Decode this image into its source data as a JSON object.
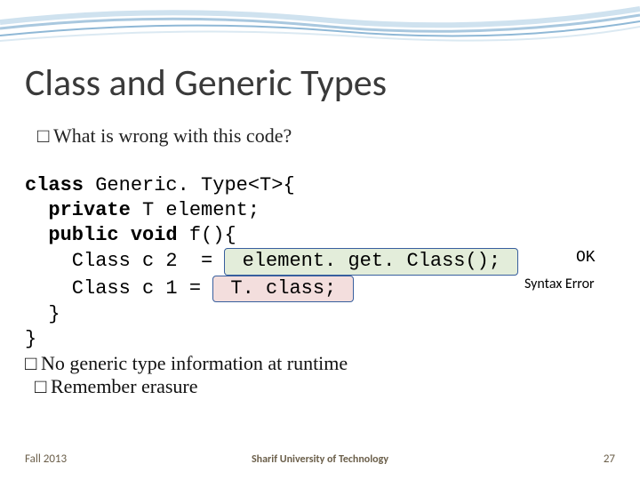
{
  "title": "Class and Generic Types",
  "bullet1": "What is wrong with this code?",
  "code": {
    "l1_a": "class",
    "l1_b": " Generic. Type<T>{",
    "l2_a": "  private",
    "l2_b": " T element;",
    "l3_a": "  public",
    "l3_b": " ",
    "l3_c": "void",
    "l3_d": " f(){",
    "l4_a": "    Class c 2  = ",
    "l4_hl": " element. get. Class(); ",
    "l5_a": "    Class c 1 = ",
    "l5_hl": " T. class; ",
    "l6": "  }",
    "l7": "}"
  },
  "annot_ok": "OK",
  "annot_err": "Syntax Error",
  "bottom1": "No generic type information at runtime",
  "bottom2": "Remember erasure",
  "footer_left": "Fall 2013",
  "footer_center": "Sharif University of Technology",
  "footer_right": "27"
}
